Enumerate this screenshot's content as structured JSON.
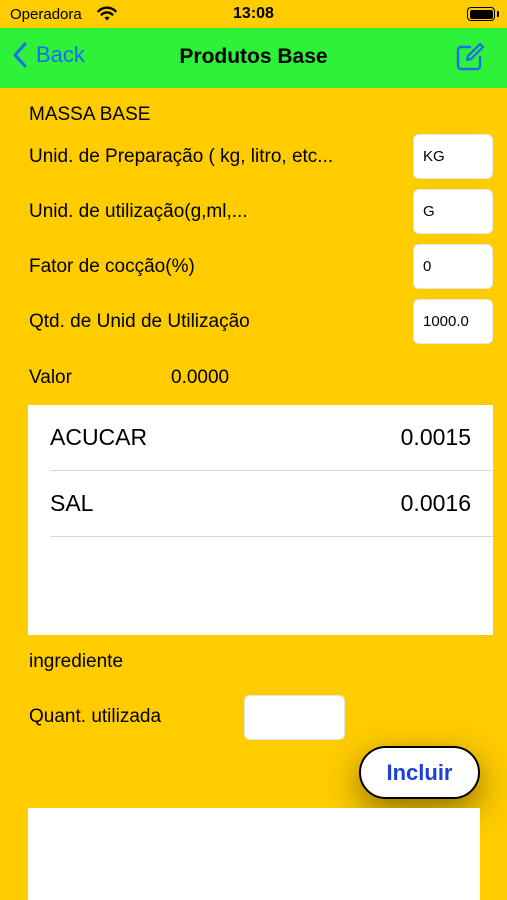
{
  "status_bar": {
    "carrier": "Operadora",
    "time": "13:08"
  },
  "nav": {
    "back_label": "Back",
    "title": "Produtos Base"
  },
  "form": {
    "section_title": "MASSA BASE",
    "rows": [
      {
        "label": "Unid. de Preparação ( kg, litro, etc...",
        "value": "KG"
      },
      {
        "label": "Unid. de utilização(g,ml,...",
        "value": "G"
      },
      {
        "label": "Fator de cocção(%)",
        "value": "0"
      },
      {
        "label": "Qtd. de Unid de Utilização",
        "value": "1000.0"
      }
    ],
    "valor_label": "Valor",
    "valor_value": "0.0000"
  },
  "ingredients_table": {
    "rows": [
      {
        "name": "ACUCAR",
        "value": "0.0015"
      },
      {
        "name": "SAL",
        "value": "0.0016"
      }
    ]
  },
  "ingredient_input": {
    "ingredient_label": "ingrediente",
    "quantity_label": "Quant. utilizada",
    "quantity_value": ""
  },
  "actions": {
    "include_label": "Incluir"
  },
  "colors": {
    "background": "#ffcc00",
    "nav_background": "#2ef13a",
    "accent": "#1a6cf0",
    "button_text": "#1d3fd6"
  }
}
